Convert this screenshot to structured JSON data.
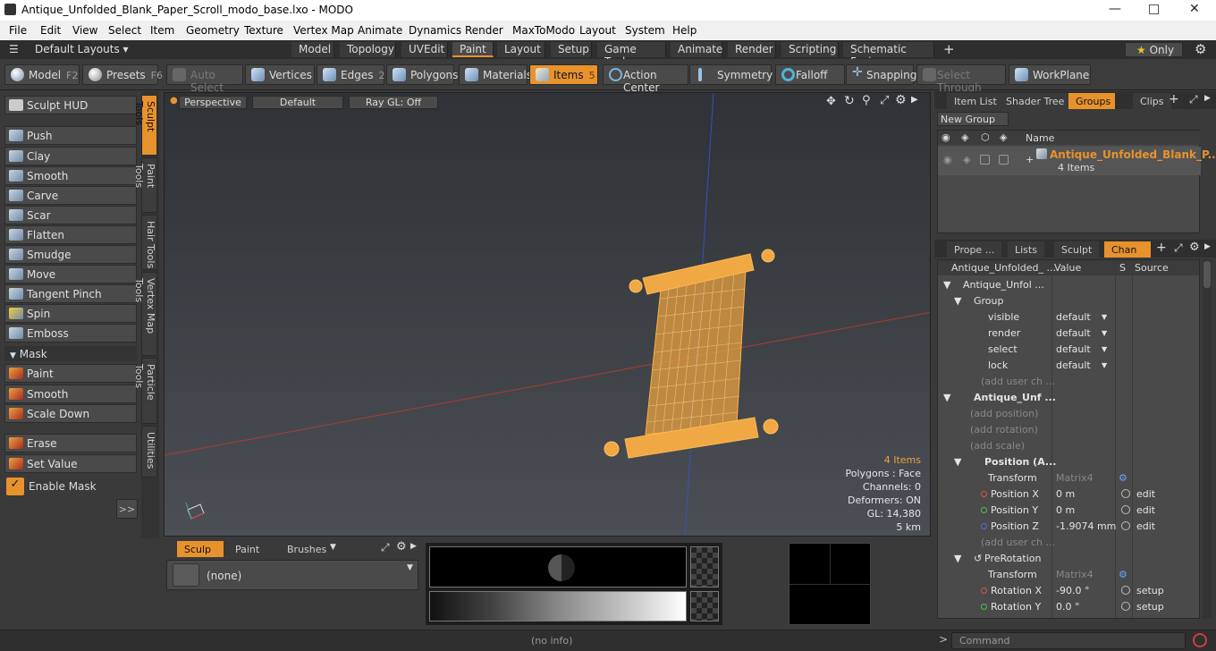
{
  "window": {
    "title": "Antique_Unfolded_Blank_Paper_Scroll_modo_base.lxo - MODO"
  },
  "menu": [
    "File",
    "Edit",
    "View",
    "Select",
    "Item",
    "Geometry",
    "Texture",
    "Vertex Map",
    "Animate",
    "Dynamics",
    "Render",
    "MaxToModo",
    "Layout",
    "System",
    "Help"
  ],
  "layouts": {
    "selector": "Default Layouts ▾",
    "tabs": [
      "Model",
      "Topology",
      "UVEdit",
      "Paint",
      "Layout",
      "Setup",
      "Game Tools",
      "Animate",
      "Render",
      "Scripting",
      "Schematic Fusion"
    ],
    "add": "+",
    "only": "Only"
  },
  "toolbar": {
    "model": "Model",
    "model_key": "F2",
    "presets": "Presets",
    "presets_key": "F6",
    "auto_select": "Auto Select",
    "vertices": "Vertices",
    "vertices_key": "1",
    "edges": "Edges",
    "edges_key": "2",
    "polygons": "Polygons",
    "materials": "Materials",
    "items": "Items",
    "items_key": "5",
    "action_center": "Action Center",
    "symmetry": "Symmetry",
    "falloff": "Falloff",
    "snapping": "Snapping",
    "select_through": "Select Through",
    "workplane": "WorkPlane"
  },
  "sculpt": {
    "hud": "Sculpt HUD",
    "tools": [
      "Push",
      "Clay",
      "Smooth",
      "Carve",
      "Scar",
      "Flatten",
      "Smudge",
      "Move",
      "Tangent Pinch",
      "Spin",
      "Emboss"
    ],
    "mask_header": "Mask",
    "mask_tools": [
      "Paint",
      "Smooth",
      "Scale Down"
    ],
    "extra_tools": [
      "Erase",
      "Set Value"
    ],
    "enable_mask": "Enable Mask",
    "more": ">>"
  },
  "vtabs": [
    "Sculpt Tools",
    "Paint Tools",
    "Hair Tools",
    "Vertex Map Tools",
    "Particle Tools",
    "Utilities"
  ],
  "viewport": {
    "view": "Perspective",
    "shading": "Default",
    "raygl": "Ray GL: Off",
    "stats": {
      "items": "4 Items",
      "polygons": "Polygons : Face",
      "channels": "Channels: 0",
      "deformers": "Deformers: ON",
      "gl": "GL: 14,380",
      "scale": "5 km"
    }
  },
  "bottom": {
    "tabs": [
      "Sculp ...",
      "Paint ...",
      "Brushes"
    ],
    "brush": "(none)"
  },
  "itemlist": {
    "tabs": [
      "Item List",
      "Shader Tree",
      "Groups",
      "Clips"
    ],
    "new_group": "New Group",
    "col_name": "Name",
    "group_name": "Antique_Unfolded_Blank_P...",
    "group_count": "4 Items"
  },
  "channels": {
    "tabs": [
      "Prope ...",
      "Lists",
      "Sculpt",
      "Chan ..."
    ],
    "headers": [
      "Antique_Unfolded_ ...",
      "Value",
      "S",
      "Source"
    ],
    "rows": [
      {
        "label": "Antique_Unfol ...",
        "value": "",
        "src": ""
      },
      {
        "label": "Group",
        "value": "",
        "src": ""
      },
      {
        "label": "visible",
        "value": "default",
        "src": ""
      },
      {
        "label": "render",
        "value": "default",
        "src": ""
      },
      {
        "label": "select",
        "value": "default",
        "src": ""
      },
      {
        "label": "lock",
        "value": "default",
        "src": ""
      },
      {
        "label": "(add user ch ...",
        "value": "",
        "src": ""
      },
      {
        "label": "Antique_Unf ...",
        "value": "",
        "src": ""
      },
      {
        "label": "(add position)",
        "value": "",
        "src": ""
      },
      {
        "label": "(add rotation)",
        "value": "",
        "src": ""
      },
      {
        "label": "(add scale)",
        "value": "",
        "src": ""
      },
      {
        "label": "Position (A...",
        "value": "",
        "src": ""
      },
      {
        "label": "Transform",
        "value": "Matrix4",
        "src": ""
      },
      {
        "label": "Position X",
        "value": "0 m",
        "src": "edit"
      },
      {
        "label": "Position Y",
        "value": "0 m",
        "src": "edit"
      },
      {
        "label": "Position Z",
        "value": "-1.9074 mm",
        "src": "edit"
      },
      {
        "label": "(add user ch ...",
        "value": "",
        "src": ""
      },
      {
        "label": "PreRotation",
        "value": "",
        "src": ""
      },
      {
        "label": "Transform",
        "value": "Matrix4",
        "src": ""
      },
      {
        "label": "Rotation X",
        "value": "-90.0 °",
        "src": "setup"
      },
      {
        "label": "Rotation Y",
        "value": "0.0 °",
        "src": "setup"
      }
    ]
  },
  "status": {
    "info": "(no info)",
    "command": "Command"
  }
}
